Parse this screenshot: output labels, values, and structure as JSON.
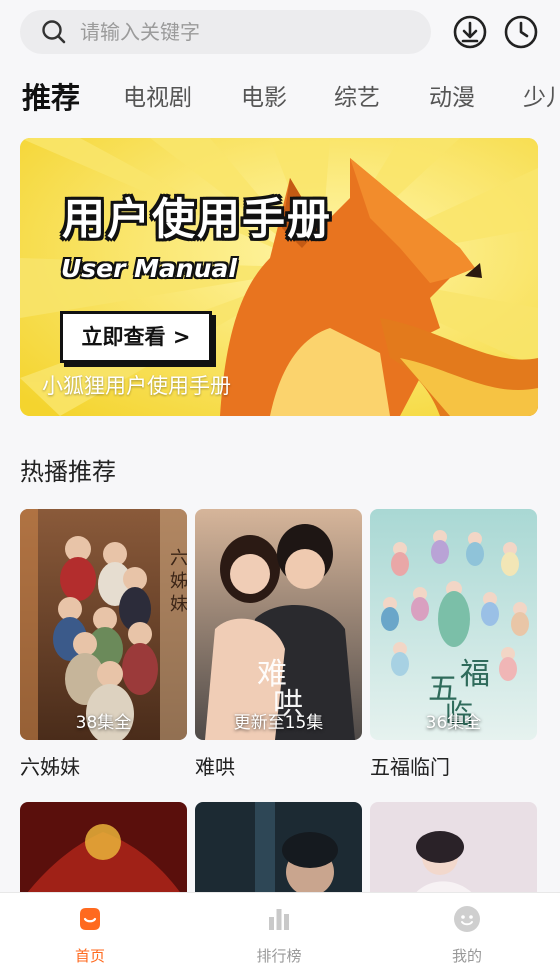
{
  "search": {
    "placeholder": "请输入关键字"
  },
  "header_icons": [
    "download-icon",
    "history-icon"
  ],
  "tabs": [
    {
      "label": "推荐",
      "active": true
    },
    {
      "label": "电视剧"
    },
    {
      "label": "电影"
    },
    {
      "label": "综艺"
    },
    {
      "label": "动漫"
    },
    {
      "label": "少儿"
    }
  ],
  "banner": {
    "title": "用户使用手册",
    "subtitle": "User Manual",
    "button": "立即查看 >",
    "caption": "小狐狸用户使用手册"
  },
  "section": {
    "title": "热播推荐"
  },
  "cards": [
    {
      "title": "六姊妹",
      "badge": "38集全"
    },
    {
      "title": "难哄",
      "badge": "更新至15集"
    },
    {
      "title": "五福临门",
      "badge": "36集全"
    }
  ],
  "nav": [
    {
      "label": "首页",
      "icon": "home-icon",
      "active": true
    },
    {
      "label": "排行榜",
      "icon": "ranking-icon"
    },
    {
      "label": "我的",
      "icon": "profile-icon"
    }
  ],
  "colors": {
    "accent": "#ff6a1f",
    "banner_bg": "#f6dd49"
  }
}
